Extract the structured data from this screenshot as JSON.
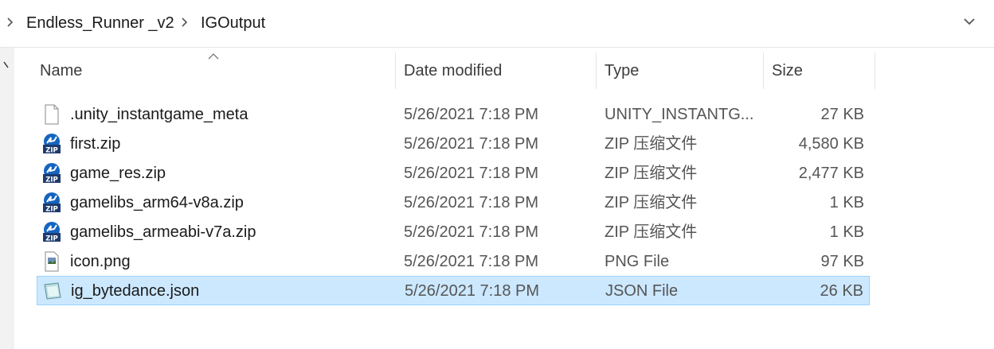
{
  "breadcrumb": {
    "items": [
      "Endless_Runner _v2",
      "IGOutput"
    ]
  },
  "columns": {
    "name": "Name",
    "date": "Date modified",
    "type": "Type",
    "size": "Size"
  },
  "files": [
    {
      "name": ".unity_instantgame_meta",
      "date": "5/26/2021 7:18 PM",
      "type": "UNITY_INSTANTG...",
      "size": "27 KB",
      "icon": "blank-file-icon",
      "selected": false
    },
    {
      "name": "first.zip",
      "date": "5/26/2021 7:18 PM",
      "type": "ZIP 压缩文件",
      "size": "4,580 KB",
      "icon": "zip-file-icon",
      "selected": false
    },
    {
      "name": "game_res.zip",
      "date": "5/26/2021 7:18 PM",
      "type": "ZIP 压缩文件",
      "size": "2,477 KB",
      "icon": "zip-file-icon",
      "selected": false
    },
    {
      "name": "gamelibs_arm64-v8a.zip",
      "date": "5/26/2021 7:18 PM",
      "type": "ZIP 压缩文件",
      "size": "1 KB",
      "icon": "zip-file-icon",
      "selected": false
    },
    {
      "name": "gamelibs_armeabi-v7a.zip",
      "date": "5/26/2021 7:18 PM",
      "type": "ZIP 压缩文件",
      "size": "1 KB",
      "icon": "zip-file-icon",
      "selected": false
    },
    {
      "name": "icon.png",
      "date": "5/26/2021 7:18 PM",
      "type": "PNG File",
      "size": "97 KB",
      "icon": "image-file-icon",
      "selected": false
    },
    {
      "name": "ig_bytedance.json",
      "date": "5/26/2021 7:18 PM",
      "type": "JSON File",
      "size": "26 KB",
      "icon": "json-file-icon",
      "selected": true
    }
  ],
  "colors": {
    "selection_bg": "#cce8ff",
    "selection_border": "#99d1ff",
    "zip_blue": "#1565c0"
  }
}
